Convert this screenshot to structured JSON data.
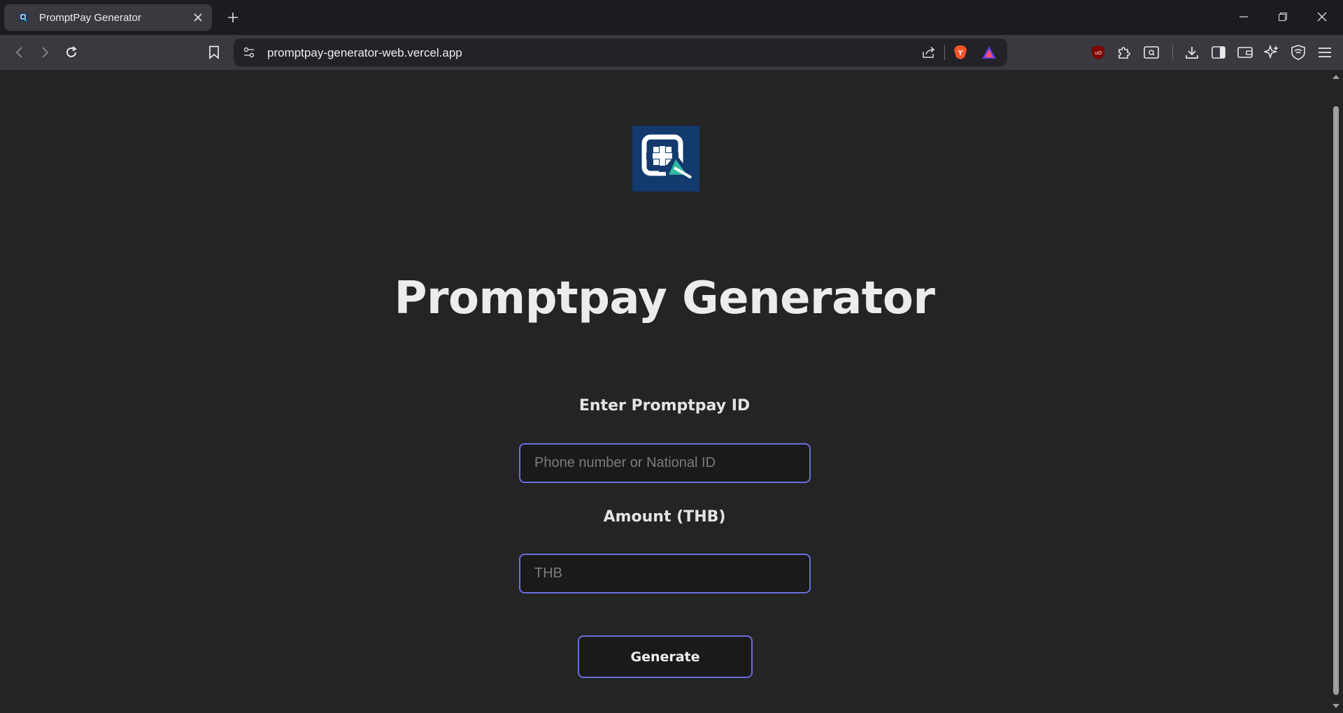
{
  "browser": {
    "tab": {
      "title": "PromptPay Generator",
      "favicon": "qr-favicon"
    },
    "url": "promptpay-generator-web.vercel.app",
    "icons": {
      "back": "arrow-left-icon",
      "forward": "arrow-right-icon",
      "reload": "reload-icon",
      "bookmark": "bookmark-icon",
      "site_settings": "site-settings-icon",
      "share": "share-icon",
      "brave_shields": "brave-lion-icon",
      "brave_rewards": "brave-rewards-icon",
      "ublock": "ublock-icon",
      "extensions": "puzzle-icon",
      "reader": "reader-mode-icon",
      "downloads": "download-icon",
      "sidebar": "sidebar-icon",
      "wallet": "wallet-icon",
      "leo": "leo-ai-icon",
      "vpn": "vpn-shield-icon",
      "menu": "hamburger-menu-icon"
    }
  },
  "page": {
    "heading": "Promptpay Generator",
    "promptpay_label": "Enter Promptpay ID",
    "promptpay_placeholder": "Phone number or National ID",
    "promptpay_value": "",
    "amount_label": "Amount (THB)",
    "amount_placeholder": "THB",
    "amount_value": "",
    "generate_label": "Generate"
  },
  "colors": {
    "background": "#242424",
    "accent_border": "#6c6ce0",
    "logo_bg": "#123a6c",
    "logo_teal": "#2fb8a0"
  }
}
